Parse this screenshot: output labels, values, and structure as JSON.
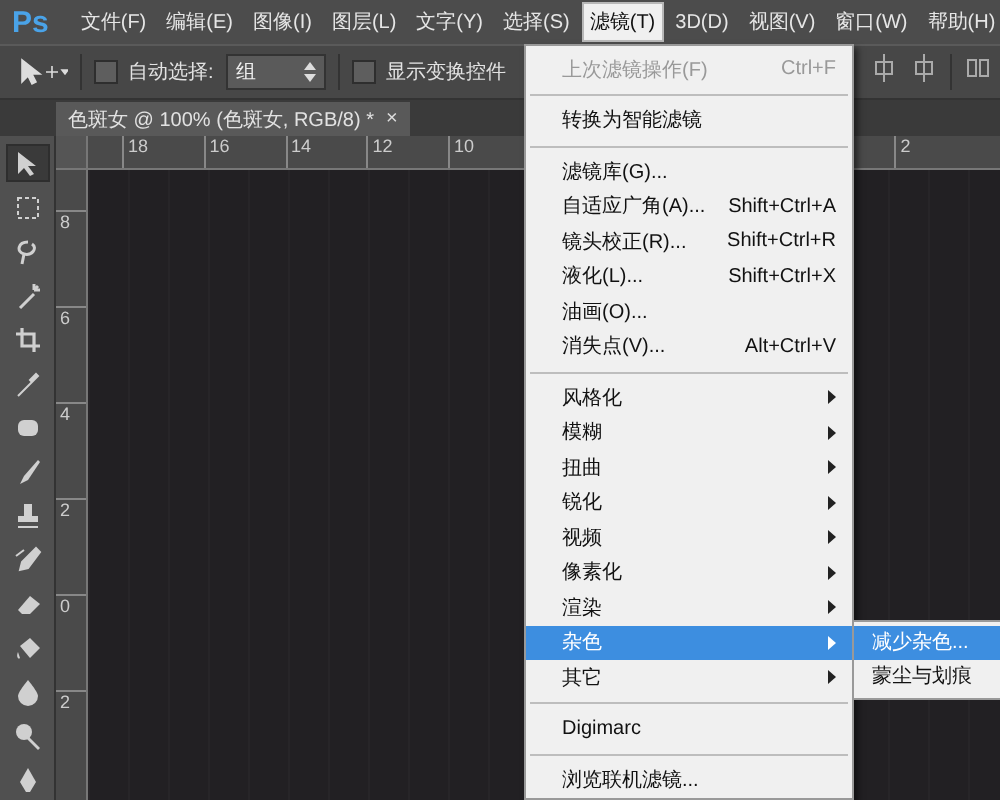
{
  "app_logo": "Ps",
  "menu_bar": [
    {
      "label": "文件(F)",
      "selected": false
    },
    {
      "label": "编辑(E)",
      "selected": false
    },
    {
      "label": "图像(I)",
      "selected": false
    },
    {
      "label": "图层(L)",
      "selected": false
    },
    {
      "label": "文字(Y)",
      "selected": false
    },
    {
      "label": "选择(S)",
      "selected": false
    },
    {
      "label": "滤镜(T)",
      "selected": true
    },
    {
      "label": "3D(D)",
      "selected": false
    },
    {
      "label": "视图(V)",
      "selected": false
    },
    {
      "label": "窗口(W)",
      "selected": false
    },
    {
      "label": "帮助(H)",
      "selected": false
    }
  ],
  "options_bar": {
    "auto_select": {
      "label": "自动选择:",
      "checked": false
    },
    "auto_select_mode": "组",
    "show_transform": {
      "label": "显示变换控件",
      "checked": false
    }
  },
  "document_tab": {
    "title": "色斑女 @ 100% (色斑女, RGB/8) *",
    "close": "×"
  },
  "ruler_top": {
    "labels": [
      "18",
      "16",
      "14",
      "12",
      "10"
    ],
    "right_labels": [
      "2"
    ]
  },
  "ruler_left": {
    "labels": [
      "8",
      "6",
      "4",
      "2",
      "0",
      "2"
    ]
  },
  "tools": [
    {
      "kind": "move",
      "selected": true
    },
    {
      "kind": "marquee",
      "selected": false
    },
    {
      "kind": "lasso",
      "selected": false
    },
    {
      "kind": "wand",
      "selected": false
    },
    {
      "kind": "crop",
      "selected": false
    },
    {
      "kind": "eyedropper",
      "selected": false
    },
    {
      "kind": "healing",
      "selected": false
    },
    {
      "kind": "brush",
      "selected": false
    },
    {
      "kind": "stamp",
      "selected": false
    },
    {
      "kind": "history",
      "selected": false
    },
    {
      "kind": "eraser",
      "selected": false
    },
    {
      "kind": "bucket",
      "selected": false
    },
    {
      "kind": "blur",
      "selected": false
    },
    {
      "kind": "dodge",
      "selected": false
    },
    {
      "kind": "pen",
      "selected": false
    }
  ],
  "filter_menu": [
    {
      "kind": "item",
      "label": "上次滤镜操作(F)",
      "shortcut": "Ctrl+F",
      "disabled": true,
      "selected": false
    },
    {
      "kind": "separator"
    },
    {
      "kind": "item",
      "label": "转换为智能滤镜",
      "disabled": false,
      "selected": false
    },
    {
      "kind": "separator"
    },
    {
      "kind": "item",
      "label": "滤镜库(G)...",
      "disabled": false,
      "selected": false
    },
    {
      "kind": "item",
      "label": "自适应广角(A)...",
      "shortcut": "Shift+Ctrl+A",
      "disabled": false,
      "selected": false
    },
    {
      "kind": "item",
      "label": "镜头校正(R)...",
      "shortcut": "Shift+Ctrl+R",
      "disabled": false,
      "selected": false
    },
    {
      "kind": "item",
      "label": "液化(L)...",
      "shortcut": "Shift+Ctrl+X",
      "disabled": false,
      "selected": false
    },
    {
      "kind": "item",
      "label": "油画(O)...",
      "disabled": false,
      "selected": false
    },
    {
      "kind": "item",
      "label": "消失点(V)...",
      "shortcut": "Alt+Ctrl+V",
      "disabled": false,
      "selected": false
    },
    {
      "kind": "separator"
    },
    {
      "kind": "submenu",
      "label": "风格化",
      "disabled": false,
      "selected": false
    },
    {
      "kind": "submenu",
      "label": "模糊",
      "disabled": false,
      "selected": false
    },
    {
      "kind": "submenu",
      "label": "扭曲",
      "disabled": false,
      "selected": false
    },
    {
      "kind": "submenu",
      "label": "锐化",
      "disabled": false,
      "selected": false
    },
    {
      "kind": "submenu",
      "label": "视频",
      "disabled": false,
      "selected": false
    },
    {
      "kind": "submenu",
      "label": "像素化",
      "disabled": false,
      "selected": false
    },
    {
      "kind": "submenu",
      "label": "渲染",
      "disabled": false,
      "selected": false
    },
    {
      "kind": "submenu",
      "label": "杂色",
      "disabled": false,
      "selected": true,
      "children": [
        {
          "label": "减少杂色...",
          "selected": true
        },
        {
          "label": "蒙尘与划痕",
          "selected": false
        }
      ]
    },
    {
      "kind": "submenu",
      "label": "其它",
      "disabled": false,
      "selected": false
    },
    {
      "kind": "separator"
    },
    {
      "kind": "item",
      "label": "Digimarc",
      "disabled": false,
      "selected": false
    },
    {
      "kind": "separator"
    },
    {
      "kind": "item",
      "label": "浏览联机滤镜...",
      "disabled": false,
      "selected": false
    }
  ]
}
